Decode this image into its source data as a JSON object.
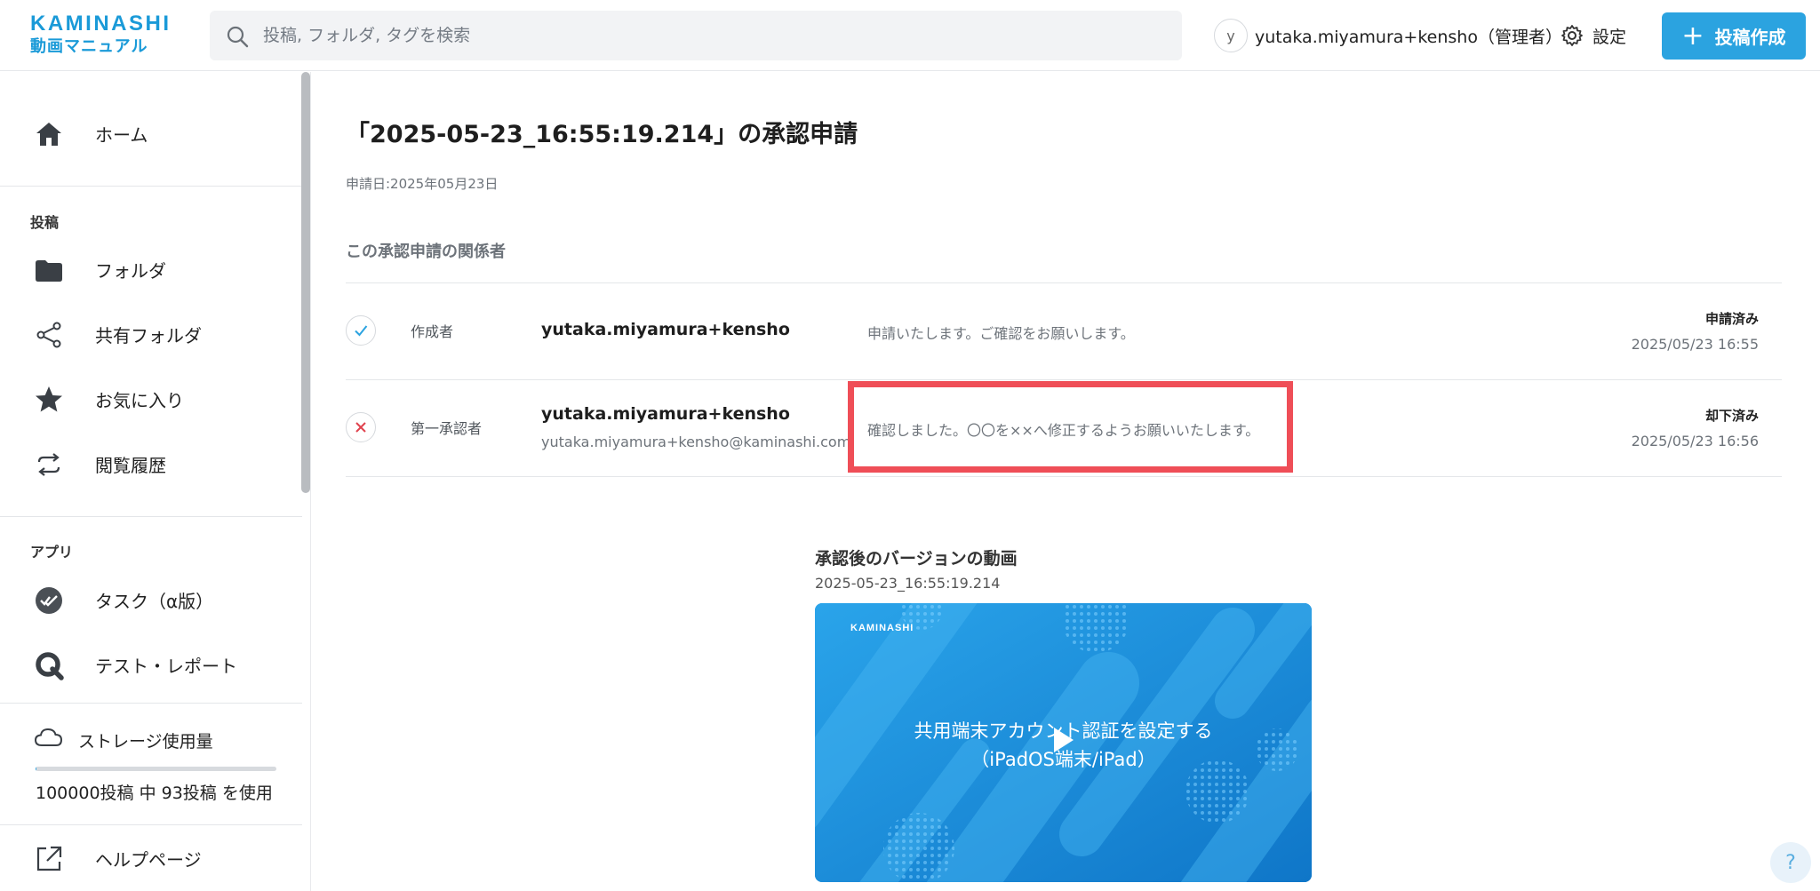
{
  "header": {
    "logo_line1": "KAMINASHI",
    "logo_line2": "動画マニュアル",
    "search_placeholder": "投稿, フォルダ, タグを検索",
    "avatar_initial": "y",
    "user_name": "yutaka.miyamura+kensho（管理者）",
    "settings_label": "設定",
    "create_button_label": "投稿作成",
    "accent_color": "#2ba3e0"
  },
  "sidebar": {
    "home_label": "ホーム",
    "section_posts": "投稿",
    "posts_items": [
      {
        "label": "フォルダ",
        "icon": "folder-icon"
      },
      {
        "label": "共有フォルダ",
        "icon": "share-icon"
      },
      {
        "label": "お気に入り",
        "icon": "star-icon"
      },
      {
        "label": "閲覧履歴",
        "icon": "history-icon"
      }
    ],
    "section_apps": "アプリ",
    "apps_items": [
      {
        "label": "タスク（α版）",
        "icon": "task-check-icon"
      },
      {
        "label": "テスト・レポート",
        "icon": "test-report-icon"
      }
    ],
    "storage": {
      "label": "ストレージ使用量",
      "text": "100000投稿 中 93投稿 を使用",
      "used": 93,
      "total": 100000
    },
    "help_label": "ヘルプページ"
  },
  "main": {
    "title": "「2025-05-23_16:55:19.214」の承認申請",
    "request_date": "申請日:2025年05月23日",
    "section_title": "この承認申請の関係者",
    "rows": [
      {
        "status_icon": "check-icon",
        "role": "作成者",
        "name": "yutaka.miyamura+kensho",
        "email": "",
        "comment": "申請いたします。ご確認をお願いします。",
        "state": "申請済み",
        "time": "2025/05/23 16:55"
      },
      {
        "status_icon": "close-icon",
        "role": "第一承認者",
        "name": "yutaka.miyamura+kensho",
        "email": "yutaka.miyamura+kensho@kaminashi.com",
        "comment": "確認しました。〇〇を××へ修正するようお願いいたします。",
        "state": "却下済み",
        "time": "2025/05/23 16:56"
      }
    ],
    "video": {
      "heading": "承認後のバージョンの動画",
      "version": "2025-05-23_16:55:19.214",
      "brand": "KAMINASHI",
      "caption_line1": "共用端末アカウント認証を設定する",
      "caption_line2": "（iPadOS端末/iPad）"
    },
    "highlight_color": "#ef4e57"
  },
  "help_button": "?"
}
